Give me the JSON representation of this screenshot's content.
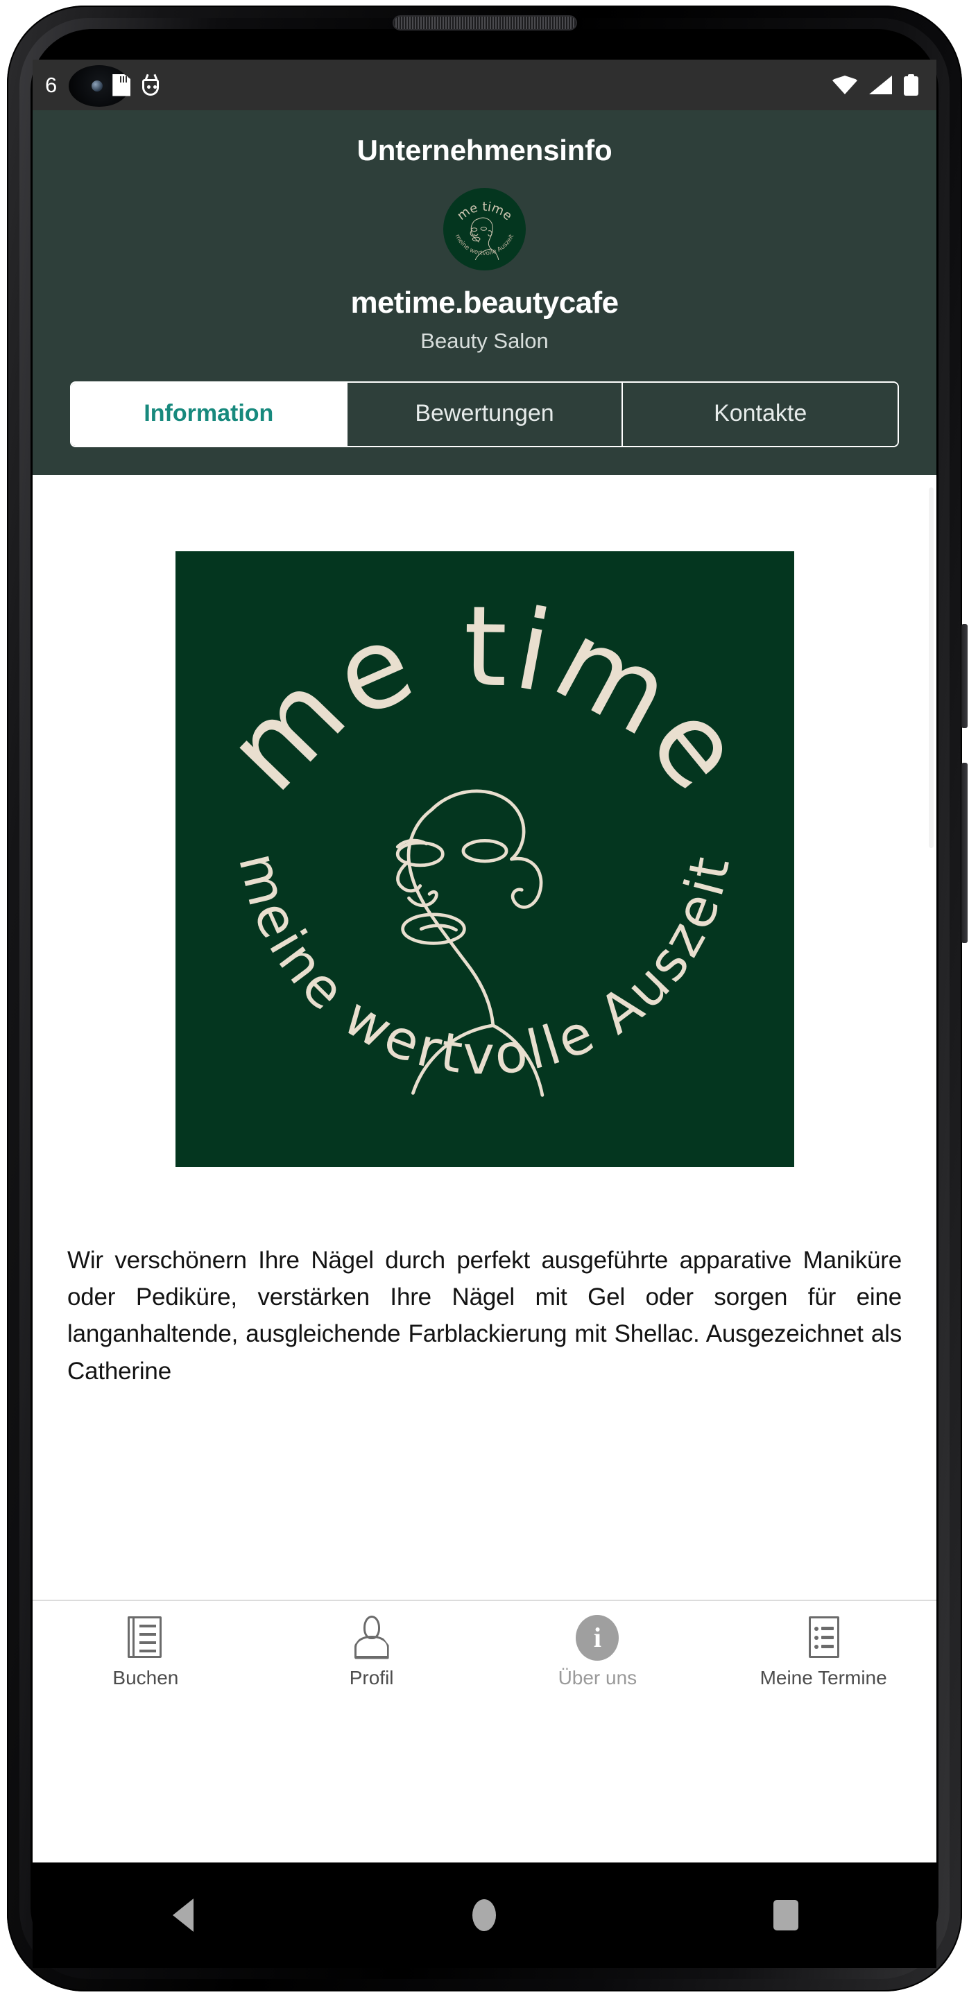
{
  "status_bar": {
    "clock": "6",
    "icons": [
      "camera-punch-hole",
      "sd-card-icon",
      "android-bug-icon",
      "wifi-icon",
      "cellular-signal-icon",
      "battery-icon"
    ]
  },
  "header": {
    "title": "Unternehmensinfo",
    "brand_name": "metime.beautycafe",
    "brand_category": "Beauty Salon",
    "background_color": "#2e3f3a",
    "avatar_alt": "me time logo"
  },
  "tabs": [
    {
      "label": "Information",
      "active": true
    },
    {
      "label": "Bewertungen",
      "active": false
    },
    {
      "label": "Kontakte",
      "active": false
    }
  ],
  "logo": {
    "top_text": "me time",
    "bottom_text": "meine wertvolle Auszeit",
    "background_color": "#04361f",
    "stroke_color": "#e9dfcf"
  },
  "description": "Wir verschönern Ihre Nägel durch perfekt ausgeführte apparative Maniküre oder Pediküre, verstärken Ihre Nägel mit Gel oder sorgen für eine langanhaltende, ausgleichende Farblackierung mit Shellac. Ausgezeichnet als Catherine",
  "bottom_nav": [
    {
      "label": "Buchen",
      "icon": "document-icon",
      "active": false
    },
    {
      "label": "Profil",
      "icon": "person-icon",
      "active": false
    },
    {
      "label": "Über uns",
      "icon": "info-circle-icon",
      "active": true
    },
    {
      "label": "Meine Termine",
      "icon": "list-icon",
      "active": false
    }
  ],
  "android_nav": {
    "back": "back-button",
    "home": "home-button",
    "recents": "recents-button"
  },
  "colors": {
    "header_green": "#2e3f3a",
    "logo_green": "#04361f",
    "accent_teal": "#17897d",
    "logo_cream": "#e9dfcf"
  }
}
